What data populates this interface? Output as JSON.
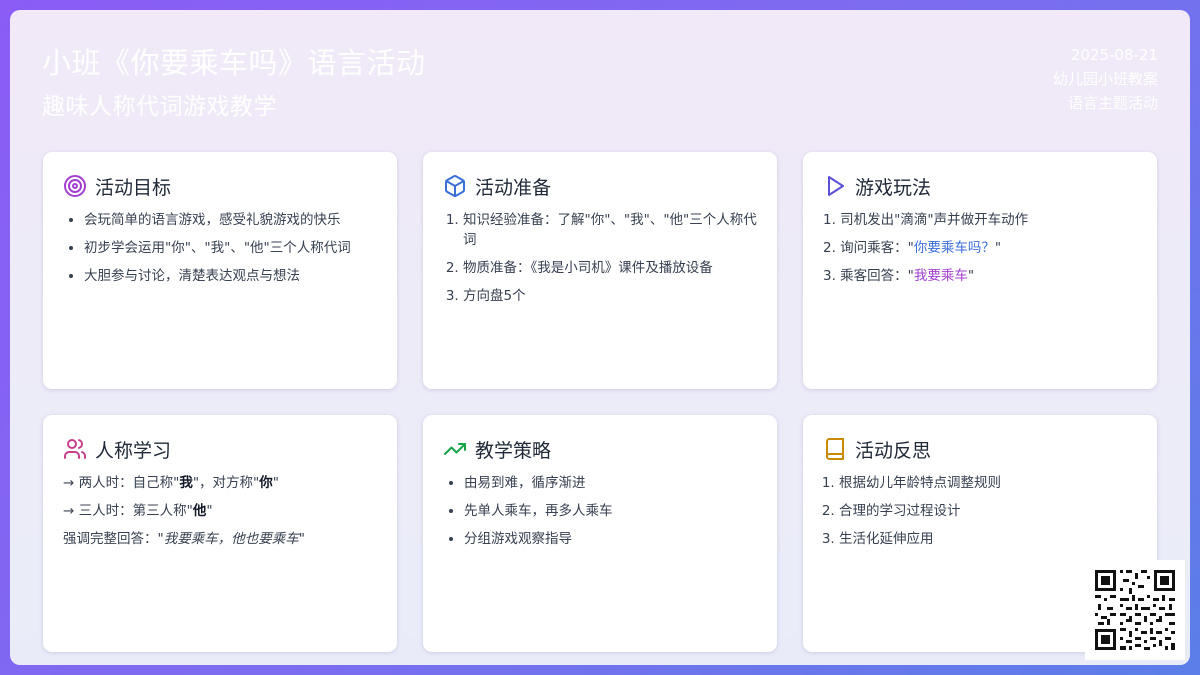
{
  "header": {
    "title": "小班《你要乘车吗》语言活动",
    "subtitle": "趣味人称代词游戏教学",
    "date": "2025-08-21",
    "meta_line1": "幼儿园小班教案",
    "meta_line2": "语言主题活动"
  },
  "cards": {
    "goals": {
      "title": "活动目标",
      "icon": "target-icon",
      "items": [
        "会玩简单的语言游戏，感受礼貌游戏的快乐",
        "初步学会运用\"你\"、\"我\"、\"他\"三个人称代词",
        "大胆参与讨论，清楚表达观点与想法"
      ]
    },
    "prep": {
      "title": "活动准备",
      "icon": "box-icon",
      "items": [
        "知识经验准备：了解\"你\"、\"我\"、\"他\"三个人称代词",
        "物质准备：《我是小司机》课件及播放设备",
        "方向盘5个"
      ]
    },
    "game": {
      "title": "游戏玩法",
      "icon": "play-icon",
      "item1": "1. 司机发出\"滴滴\"声并做开车动作",
      "item2_prefix": "2. 询问乘客：\"",
      "item2_highlight": "你要乘车吗？",
      "item2_suffix": "\"",
      "item3_prefix": "3. 乘客回答：\"",
      "item3_highlight": "我要乘车",
      "item3_suffix": "\""
    },
    "person": {
      "title": "人称学习",
      "icon": "users-icon",
      "line1_prefix": "→ 两人时：自己称\"",
      "line1_bold1": "我",
      "line1_mid": "\"，对方称\"",
      "line1_bold2": "你",
      "line1_suffix": "\"",
      "line2_prefix": "→ 三人时：第三人称\"",
      "line2_bold": "他",
      "line2_suffix": "\"",
      "line3_prefix": "强调完整回答：\"",
      "line3_italic": "我要乘车，他也要乘车",
      "line3_suffix": "\""
    },
    "strategy": {
      "title": "教学策略",
      "icon": "trending-up-icon",
      "items": [
        "由易到难，循序渐进",
        "先单人乘车，再多人乘车",
        "分组游戏观察指导"
      ]
    },
    "reflect": {
      "title": "活动反思",
      "icon": "book-icon",
      "items": [
        "根据幼儿年龄特点调整规则",
        "合理的学习过程设计",
        "生活化延伸应用"
      ]
    }
  },
  "colors": {
    "target": "#a33fd1",
    "box": "#3b6fd8",
    "play": "#5b4fd6",
    "users": "#c8408c",
    "trend": "#16a34a",
    "book": "#ca8a04",
    "highlight_blue": "#3b6fd8",
    "highlight_purple": "#a23fd0"
  }
}
